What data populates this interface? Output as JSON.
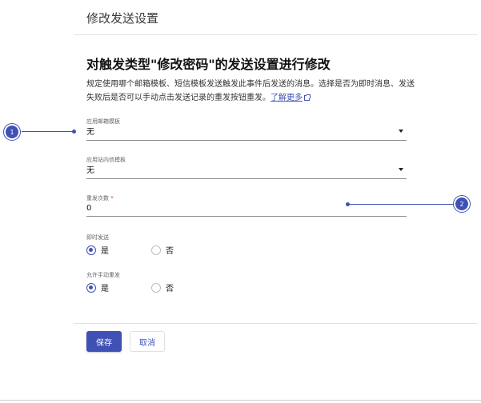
{
  "page": {
    "title": "修改发送设置"
  },
  "section": {
    "title": "对触发类型\"修改密码\"的发送设置进行修改",
    "description": "规定使用哪个邮箱模板、短信模板发送触发此事件后发送的消息。选择是否为即时消息、发送失败后是否可以手动点击发送记录的重发按钮重发。",
    "learn_more": "了解更多"
  },
  "fields": {
    "email_template": {
      "label": "应用邮箱模板",
      "value": "无"
    },
    "inbox_template": {
      "label": "应用站内信模板",
      "value": "无"
    },
    "retry_count": {
      "label": "重发次数",
      "required_mark": "*",
      "value": "0"
    },
    "instant_send": {
      "label": "即时发送",
      "options": [
        "是",
        "否"
      ],
      "selected": "是"
    },
    "allow_manual_resend": {
      "label": "允许手动重发",
      "options": [
        "是",
        "否"
      ],
      "selected": "是"
    }
  },
  "actions": {
    "save": "保存",
    "cancel": "取消"
  },
  "annotations": [
    "1",
    "2"
  ],
  "colors": {
    "primary": "#3f51b5",
    "required": "#d32f2f"
  }
}
